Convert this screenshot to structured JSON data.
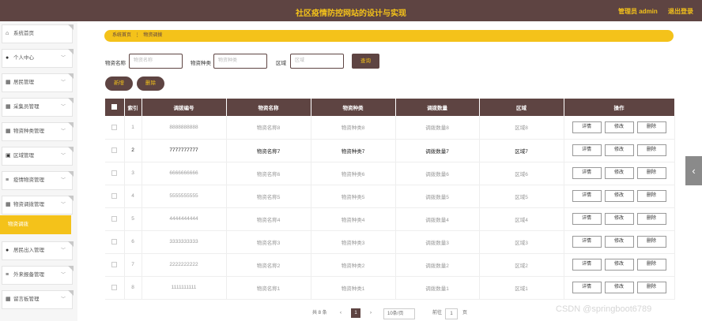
{
  "header": {
    "title": "社区疫情防控网站的设计与实现",
    "user_label": "管理员 admin",
    "logout_label": "退出登录"
  },
  "sidebar": {
    "items": [
      {
        "label": "系统首页",
        "icon": "home-icon",
        "glyph": "⌂"
      },
      {
        "label": "个人中心",
        "icon": "user-icon",
        "glyph": "●"
      },
      {
        "label": "居民管理",
        "icon": "grid-icon",
        "glyph": "▦"
      },
      {
        "label": "采集员管理",
        "icon": "grid-icon",
        "glyph": "▦"
      },
      {
        "label": "物资种类管理",
        "icon": "grid-icon",
        "glyph": "▦"
      },
      {
        "label": "区域管理",
        "icon": "checkbox-icon",
        "glyph": "▣"
      },
      {
        "label": "疫情物资管理",
        "icon": "list-icon",
        "glyph": "≡"
      },
      {
        "label": "物资调拨管理",
        "icon": "grid-icon",
        "glyph": "▦"
      },
      {
        "label": "居民出入管理",
        "icon": "user-icon",
        "glyph": "●"
      },
      {
        "label": "外来报备管理",
        "icon": "list-icon",
        "glyph": "≡"
      },
      {
        "label": "留言板管理",
        "icon": "grid-icon",
        "glyph": "▦"
      }
    ],
    "active_sub": "物资调拨"
  },
  "breadcrumb": {
    "home": "系统首页",
    "sep": "⋮",
    "current": "物资调拨"
  },
  "search": {
    "name_label": "物资名称",
    "name_placeholder": "物资名称",
    "type_label": "物资种类",
    "type_placeholder": "物资种类",
    "area_label": "区域",
    "area_placeholder": "区域",
    "button": "查询"
  },
  "actions": {
    "add": "新增",
    "delete": "删除"
  },
  "table": {
    "headers": [
      "索引",
      "调拨编号",
      "物资名称",
      "物资种类",
      "调拨数量",
      "区域",
      "操作"
    ],
    "row_actions": [
      "详情",
      "修改",
      "删除"
    ],
    "rows": [
      {
        "index": "1",
        "code": "8888888888",
        "name": "物资名称8",
        "type": "物资种类8",
        "qty": "调拨数量8",
        "area": "区域8"
      },
      {
        "index": "2",
        "code": "7777777777",
        "name": "物资名称7",
        "type": "物资种类7",
        "qty": "调拨数量7",
        "area": "区域7"
      },
      {
        "index": "3",
        "code": "6666666666",
        "name": "物资名称6",
        "type": "物资种类6",
        "qty": "调拨数量6",
        "area": "区域6"
      },
      {
        "index": "4",
        "code": "5555555555",
        "name": "物资名称5",
        "type": "物资种类5",
        "qty": "调拨数量5",
        "area": "区域5"
      },
      {
        "index": "5",
        "code": "4444444444",
        "name": "物资名称4",
        "type": "物资种类4",
        "qty": "调拨数量4",
        "area": "区域4"
      },
      {
        "index": "6",
        "code": "3333333333",
        "name": "物资名称3",
        "type": "物资种类3",
        "qty": "调拨数量3",
        "area": "区域3"
      },
      {
        "index": "7",
        "code": "2222222222",
        "name": "物资名称2",
        "type": "物资种类2",
        "qty": "调拨数量2",
        "area": "区域2"
      },
      {
        "index": "8",
        "code": "1111111111",
        "name": "物资名称1",
        "type": "物资种类1",
        "qty": "调拨数量1",
        "area": "区域1"
      }
    ]
  },
  "pager": {
    "total": "共 8 条",
    "prev": "‹",
    "current": "1",
    "next": "›",
    "size": "10条/页",
    "goto": "前往",
    "goto_value": "1",
    "page_unit": "页"
  },
  "side_tab": "‹",
  "watermark": "CSDN @springboot6789"
}
